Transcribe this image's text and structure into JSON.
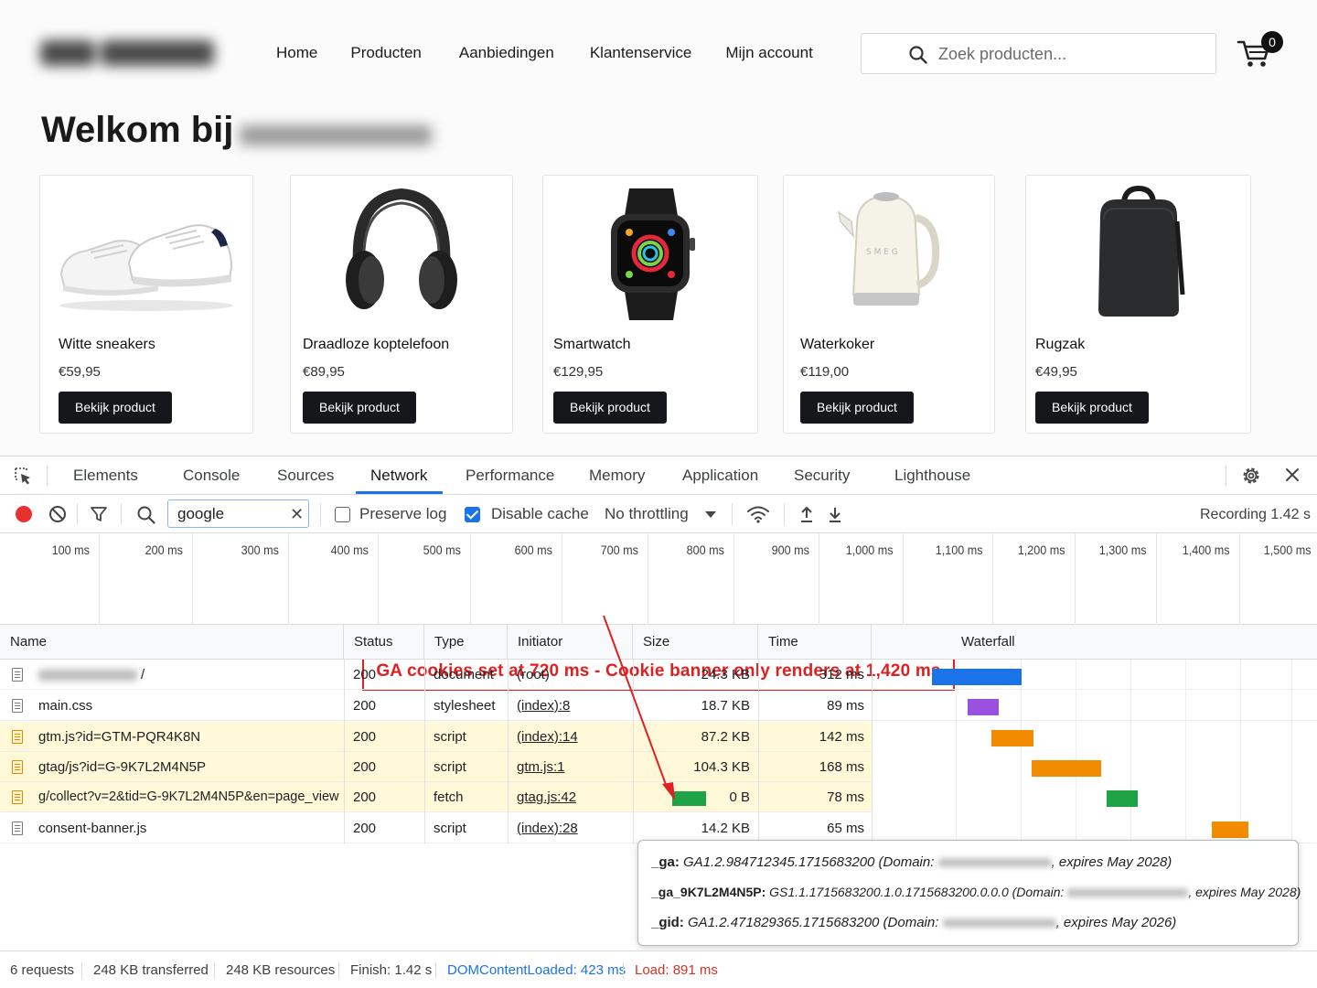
{
  "shop": {
    "nav": [
      "Home",
      "Producten",
      "Aanbiedingen",
      "Klantenservice",
      "Mijn account"
    ],
    "search_placeholder": "Zoek producten...",
    "cart_count": "0",
    "welcome": "Welkom bij",
    "products": [
      {
        "name": "Witte sneakers",
        "price": "€59,95",
        "button": "Bekijk product",
        "icon": "sneakers-image"
      },
      {
        "name": "Draadloze koptelefoon",
        "price": "€89,95",
        "button": "Bekijk product",
        "icon": "headphones-image"
      },
      {
        "name": "Smartwatch",
        "price": "€129,95",
        "button": "Bekijk product",
        "icon": "smartwatch-image"
      },
      {
        "name": "Waterkoker",
        "price": "€119,00",
        "button": "Bekijk product",
        "icon": "kettle-image"
      },
      {
        "name": "Rugzak",
        "price": "€49,95",
        "button": "Bekijk product",
        "icon": "backpack-image"
      }
    ]
  },
  "devtools": {
    "tabs": [
      "Elements",
      "Console",
      "Sources",
      "Network",
      "Performance",
      "Memory",
      "Application",
      "Security",
      "Lighthouse"
    ],
    "active_tab": "Network",
    "toolbar": {
      "filter_value": "google",
      "preserve_log": "Preserve log",
      "preserve_log_checked": false,
      "disable_cache": "Disable cache",
      "disable_cache_checked": true,
      "throttling": "No throttling",
      "recording": "Recording 1.42 s"
    },
    "timeline_ticks": [
      "100 ms",
      "200 ms",
      "300 ms",
      "400 ms",
      "500 ms",
      "600 ms",
      "700 ms",
      "800 ms",
      "900 ms",
      "1,000 ms",
      "1,100 ms",
      "1,200 ms",
      "1,300 ms",
      "1,400 ms",
      "1,500 ms"
    ],
    "callout": "GA cookies set at 720 ms - Cookie banner only renders at 1,420 ms",
    "columns": [
      "Name",
      "Status",
      "Type",
      "Initiator",
      "Size",
      "Time",
      "Waterfall"
    ],
    "requests": [
      {
        "name": "/",
        "status": "200",
        "type": "document",
        "initiator": "(root)",
        "size": "24.3 KB",
        "time": "312 ms",
        "highlight": false,
        "bar_color": "#1a73e8"
      },
      {
        "name": "main.css",
        "status": "200",
        "type": "stylesheet",
        "initiator": "(index):8",
        "size": "18.7 KB",
        "time": "89 ms",
        "highlight": false,
        "bar_color": "#9b51e0"
      },
      {
        "name": "gtm.js?id=GTM-PQR4K8N",
        "status": "200",
        "type": "script",
        "initiator": "(index):14",
        "size": "87.2 KB",
        "time": "142 ms",
        "highlight": true,
        "bar_color": "#f28b00"
      },
      {
        "name": "gtag/js?id=G-9K7L2M4N5P",
        "status": "200",
        "type": "script",
        "initiator": "gtm.js:1",
        "size": "104.3 KB",
        "time": "168 ms",
        "highlight": true,
        "bar_color": "#f28b00"
      },
      {
        "name": "g/collect?v=2&tid=G-9K7L2M4N5P&en=page_view",
        "status": "200",
        "type": "fetch",
        "initiator": "gtag.js:42",
        "size": "0 B",
        "time": "78 ms",
        "highlight": true,
        "bar_color": "#1ea446"
      },
      {
        "name": "consent-banner.js",
        "status": "200",
        "type": "script",
        "initiator": "(index):28",
        "size": "14.2 KB",
        "time": "65 ms",
        "highlight": false,
        "bar_color": "#f28b00"
      }
    ],
    "cookies": [
      {
        "key": "_ga:",
        "value": "GA1.2.984712345.1715683200 (Domain:",
        "tail": ", expires May 2028)"
      },
      {
        "key": "_ga_9K7L2M4N5P:",
        "value": "GS1.1.1715683200.1.0.1715683200.0.0.0 (Domain:",
        "tail": ", expires May 2028)"
      },
      {
        "key": "_gid:",
        "value": "GA1.2.471829365.1715683200 (Domain:",
        "tail": ", expires May 2026)"
      }
    ],
    "status_bar": {
      "requests": "6 requests",
      "transferred": "248 KB transferred",
      "resources": "248 KB resources",
      "finish": "Finish: 1.42 s",
      "dcl": "DOMContentLoaded: 423 ms",
      "load": "Load: 891 ms"
    },
    "colors": {
      "dcl": "#1a73e8",
      "load": "#d93025",
      "callout": "#e02020",
      "record": "#e8312f"
    }
  }
}
